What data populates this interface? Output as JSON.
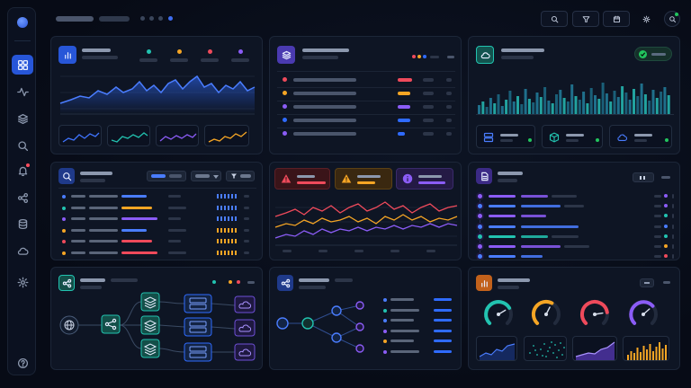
{
  "theme": {
    "accent_blue": "#2f6bff",
    "accent_teal": "#22c3b0",
    "accent_orange": "#f5a524",
    "accent_red": "#ef4a5b",
    "accent_purple": "#8b5cf6",
    "accent_green": "#22c55e"
  },
  "sidebar": {
    "items": [
      {
        "icon": "grid-icon",
        "active": true
      },
      {
        "icon": "activity-icon",
        "active": false
      },
      {
        "icon": "layers-icon",
        "active": false
      },
      {
        "icon": "search-icon",
        "active": false
      },
      {
        "icon": "bell-icon",
        "active": false,
        "notification": true
      },
      {
        "icon": "share-nodes-icon",
        "active": false
      },
      {
        "icon": "database-icon",
        "active": false
      },
      {
        "icon": "cloud-icon",
        "active": false
      },
      {
        "icon": "gear-icon",
        "active": false
      },
      {
        "icon": "help-icon",
        "active": false
      }
    ]
  },
  "topbar": {
    "buttons": [
      "search-icon",
      "filter-icon",
      "calendar-icon",
      "sun-icon",
      "user-search-icon"
    ]
  },
  "cards": {
    "analytics": {
      "icon": "bar-chart-icon",
      "legend_colors": [
        "#22c3b0",
        "#f5a524",
        "#ef4a5b",
        "#8b5cf6"
      ]
    },
    "layers_list": {
      "icon": "layers-icon",
      "row_colors": [
        "#ef4a5b",
        "#f5a524",
        "#8b5cf6",
        "#2f6bff",
        "#8b5cf6"
      ]
    },
    "cloud_metrics": {
      "icon": "cloud-icon",
      "status": "check-icon",
      "tiles": [
        "server-icon",
        "cube-icon",
        "cloud-icon"
      ]
    },
    "search_table": {
      "icon": "search-icon"
    },
    "alerts": {
      "items": [
        {
          "icon": "warning-icon",
          "color": "#ef4a5b"
        },
        {
          "icon": "warning-icon",
          "color": "#f5a524"
        },
        {
          "icon": "info-icon",
          "color": "#8b5cf6"
        }
      ]
    },
    "document_list": {
      "icon": "document-icon"
    },
    "network_topology": {
      "icon": "share-nodes-icon"
    },
    "graph_network": {
      "icon": "share-nodes-icon"
    },
    "gauges": {
      "icon": "bar-chart-icon",
      "gauge_colors": [
        "#22c3b0",
        "#f5a524",
        "#ef4a5b",
        "#8b5cf6"
      ]
    }
  }
}
